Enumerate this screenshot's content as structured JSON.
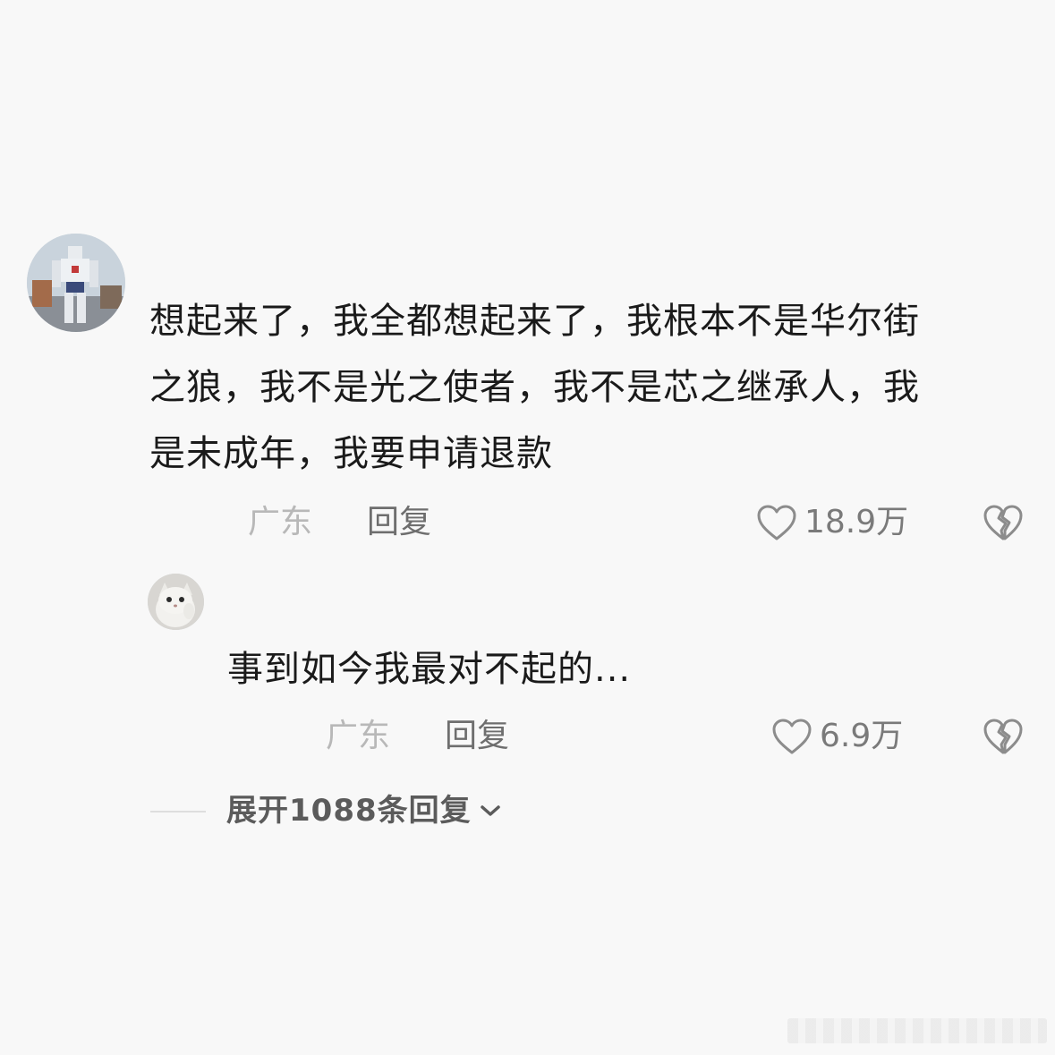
{
  "comment": {
    "text_lines": [
      "想起来了，我全都想起来了，我根本不是华尔街",
      "之狼，我不是光之使者，我不是芯之继承人，我",
      "是未成年，我要申请退款"
    ],
    "location": "广东",
    "reply_label": "回复",
    "likes": "18.9万",
    "avatar": "gundam-statue-photo"
  },
  "reply": {
    "text": "事到如今我最对不起的...",
    "location": "广东",
    "reply_label": "回复",
    "likes": "6.9万",
    "avatar": "white-cat-photo"
  },
  "expand": {
    "label": "展开1088条回复",
    "icon": "chevron-down-icon"
  },
  "icons": {
    "like": "heart-outline-icon",
    "dislike": "broken-heart-icon"
  },
  "colors": {
    "background": "#f8f8f8",
    "text": "#1a1a1a",
    "meta_light": "#b8b8b8",
    "meta_dark": "#6e6e6e"
  }
}
